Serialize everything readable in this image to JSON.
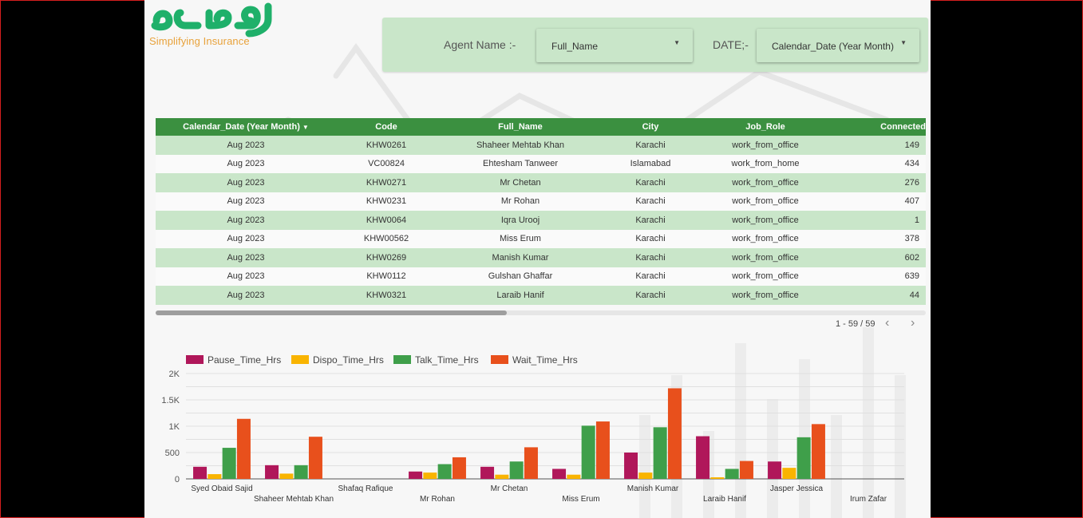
{
  "brand": {
    "tagline": "Simplifying Insurance",
    "logo_color": "#1fb06a",
    "tagline_color": "#e8a23b"
  },
  "filters": {
    "agent_label": "Agent Name :-",
    "agent_value": "Full_Name",
    "date_label": "DATE;-",
    "date_value": "Calendar_Date (Year Month)"
  },
  "table": {
    "columns": [
      "Calendar_Date (Year Month)",
      "Code",
      "Full_Name",
      "City",
      "Job_Role",
      "Connected"
    ],
    "sort_icon": "sort-desc-icon",
    "rows": [
      [
        "Aug 2023",
        "KHW0261",
        "Shaheer Mehtab Khan",
        "Karachi",
        "work_from_office",
        "149"
      ],
      [
        "Aug 2023",
        "VC00824",
        "Ehtesham Tanweer",
        "Islamabad",
        "work_from_home",
        "434"
      ],
      [
        "Aug 2023",
        "KHW0271",
        "Mr Chetan",
        "Karachi",
        "work_from_office",
        "276"
      ],
      [
        "Aug 2023",
        "KHW0231",
        "Mr Rohan",
        "Karachi",
        "work_from_office",
        "407"
      ],
      [
        "Aug 2023",
        "KHW0064",
        "Iqra Urooj",
        "Karachi",
        "work_from_office",
        "1"
      ],
      [
        "Aug 2023",
        "KHW00562",
        "Miss Erum",
        "Karachi",
        "work_from_office",
        "378"
      ],
      [
        "Aug 2023",
        "KHW0269",
        "Manish Kumar",
        "Karachi",
        "work_from_office",
        "602"
      ],
      [
        "Aug 2023",
        "KHW0112",
        "Gulshan Ghaffar",
        "Karachi",
        "work_from_office",
        "639"
      ],
      [
        "Aug 2023",
        "KHW0321",
        "Laraib Hanif",
        "Karachi",
        "work_from_office",
        "44"
      ]
    ],
    "header_color": "#3b9040",
    "odd_row_color": "#c9e6c9"
  },
  "pagination": {
    "text": "1 - 59 / 59",
    "prev_icon": "chevron-left-icon",
    "next_icon": "chevron-right-icon"
  },
  "chart_data": {
    "type": "bar",
    "categories": [
      "Syed Obaid Sajid",
      "Shaheer Mehtab Khan",
      "Shafaq Rafique",
      "Mr Rohan",
      "Mr Chetan",
      "Miss Erum",
      "Manish Kumar",
      "Laraib Hanif",
      "Jasper Jessica",
      "Irum Zafar"
    ],
    "series": [
      {
        "name": "Pause_Time_Hrs",
        "color": "#b0175a",
        "values": [
          230,
          260,
          0,
          140,
          230,
          190,
          500,
          810,
          330,
          0
        ]
      },
      {
        "name": "Dispo_Time_Hrs",
        "color": "#f9b400",
        "values": [
          90,
          100,
          0,
          120,
          80,
          80,
          120,
          30,
          210,
          0
        ]
      },
      {
        "name": "Talk_Time_Hrs",
        "color": "#3f9f4a",
        "values": [
          590,
          260,
          0,
          280,
          330,
          1010,
          980,
          190,
          790,
          0
        ]
      },
      {
        "name": "Wait_Time_Hrs",
        "color": "#e8501c",
        "values": [
          1140,
          800,
          0,
          410,
          600,
          1090,
          1720,
          340,
          1040,
          0
        ]
      }
    ],
    "ylim": [
      0,
      2000
    ],
    "yticks": [
      0,
      500,
      1000,
      1500,
      2000
    ],
    "ytick_labels": [
      "0",
      "500",
      "1K",
      "1.5K",
      "2K"
    ],
    "grid": true,
    "legend": "top-left"
  }
}
